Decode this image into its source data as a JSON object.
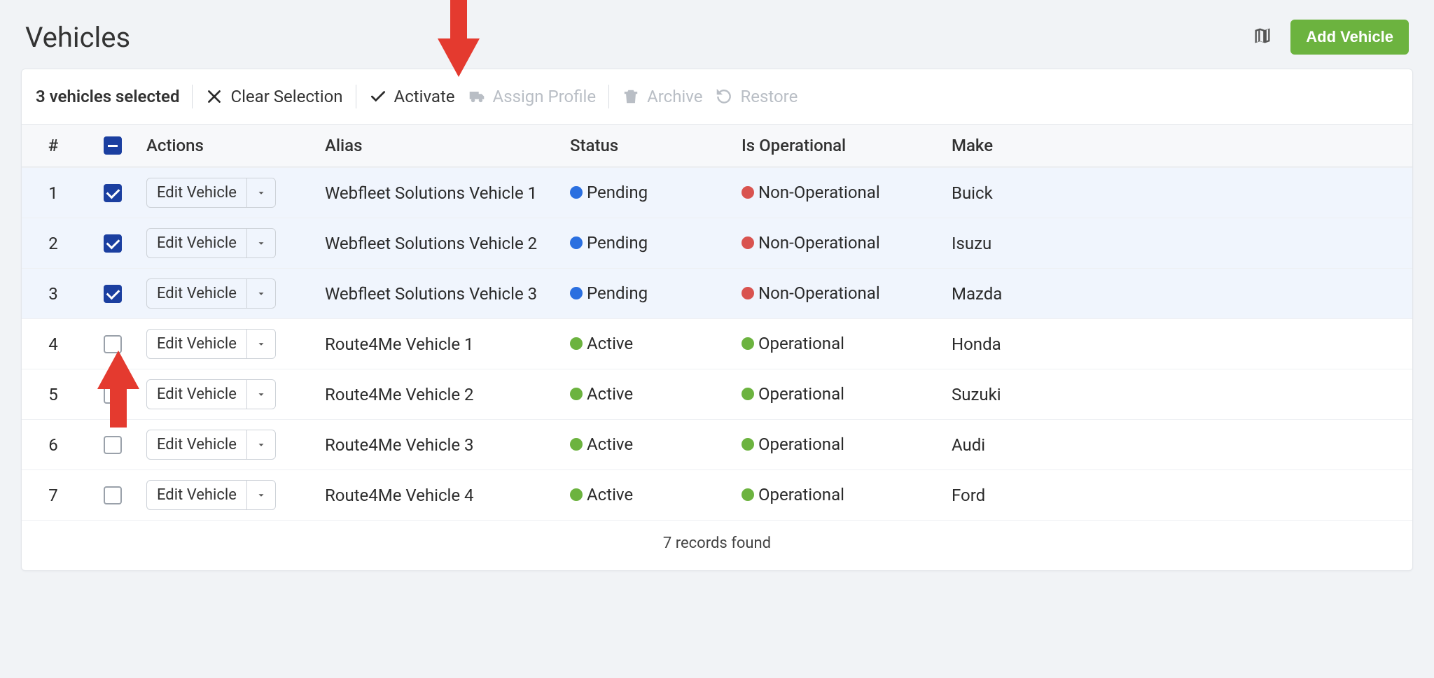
{
  "page": {
    "title": "Vehicles",
    "add_button": "Add Vehicle"
  },
  "toolbar": {
    "selected_count_text": "3 vehicles selected",
    "clear_selection": "Clear Selection",
    "activate": "Activate",
    "assign_profile": "Assign Profile",
    "archive": "Archive",
    "restore": "Restore"
  },
  "columns": {
    "num": "#",
    "actions": "Actions",
    "alias": "Alias",
    "status": "Status",
    "is_operational": "Is Operational",
    "make": "Make"
  },
  "edit_button_label": "Edit Vehicle",
  "rows": [
    {
      "num": "1",
      "selected": true,
      "alias": "Webfleet Solutions Vehicle 1",
      "status": "Pending",
      "status_color": "blue",
      "operational": "Non-Operational",
      "op_color": "red",
      "make": "Buick"
    },
    {
      "num": "2",
      "selected": true,
      "alias": "Webfleet Solutions Vehicle 2",
      "status": "Pending",
      "status_color": "blue",
      "operational": "Non-Operational",
      "op_color": "red",
      "make": "Isuzu"
    },
    {
      "num": "3",
      "selected": true,
      "alias": "Webfleet Solutions Vehicle 3",
      "status": "Pending",
      "status_color": "blue",
      "operational": "Non-Operational",
      "op_color": "red",
      "make": "Mazda"
    },
    {
      "num": "4",
      "selected": false,
      "alias": "Route4Me Vehicle 1",
      "status": "Active",
      "status_color": "green",
      "operational": "Operational",
      "op_color": "green",
      "make": "Honda"
    },
    {
      "num": "5",
      "selected": false,
      "alias": "Route4Me Vehicle 2",
      "status": "Active",
      "status_color": "green",
      "operational": "Operational",
      "op_color": "green",
      "make": "Suzuki"
    },
    {
      "num": "6",
      "selected": false,
      "alias": "Route4Me Vehicle 3",
      "status": "Active",
      "status_color": "green",
      "operational": "Operational",
      "op_color": "green",
      "make": "Audi"
    },
    {
      "num": "7",
      "selected": false,
      "alias": "Route4Me Vehicle 4",
      "status": "Active",
      "status_color": "green",
      "operational": "Operational",
      "op_color": "green",
      "make": "Ford"
    }
  ],
  "footer": {
    "records_found": "7 records found"
  }
}
